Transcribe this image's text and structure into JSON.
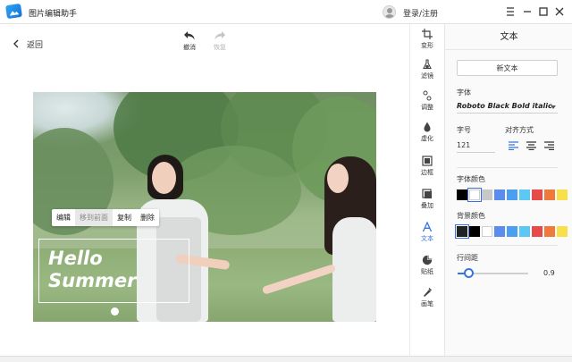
{
  "app": {
    "title": "图片编辑助手",
    "login": "登录/注册"
  },
  "toolbar": {
    "back": "返回",
    "undo": "撤消",
    "redo": "恢复"
  },
  "context_menu": {
    "items": [
      "编辑",
      "移到前面",
      "复制",
      "删除"
    ],
    "active_index": 1
  },
  "canvas": {
    "text_line1": "Hello",
    "text_line2": "Summer"
  },
  "sidebar": {
    "items": [
      {
        "label": "变形",
        "icon": "crop-icon"
      },
      {
        "label": "滤镜",
        "icon": "flask-icon"
      },
      {
        "label": "调整",
        "icon": "adjust-icon"
      },
      {
        "label": "虚化",
        "icon": "drop-icon"
      },
      {
        "label": "边框",
        "icon": "frame-icon"
      },
      {
        "label": "叠加",
        "icon": "overlay-icon"
      },
      {
        "label": "文本",
        "icon": "text-icon"
      },
      {
        "label": "贴纸",
        "icon": "sticker-icon"
      },
      {
        "label": "画笔",
        "icon": "brush-icon"
      }
    ],
    "active": "文本"
  },
  "panel": {
    "title": "文本",
    "new_text": "新文本",
    "font_label": "字体",
    "font_value": "Roboto Black Bold italic",
    "size_label": "字号",
    "size_value": "121",
    "align_label": "对齐方式",
    "align_options": [
      "align-left-icon",
      "align-center-icon",
      "align-right-icon"
    ],
    "font_color_label": "字体颜色",
    "font_colors": [
      "#000000",
      "#ffffff",
      "#c8c8c8",
      "#5b8def",
      "#4a9ff0",
      "#5bc8f5",
      "#e84a4a",
      "#f07a3c",
      "#f8e04a"
    ],
    "font_color_selected": 1,
    "bg_color_label": "背景颜色",
    "bg_colors": [
      "#222222",
      "#000000",
      "#ffffff",
      "#5b8def",
      "#4a9ff0",
      "#5bc8f5",
      "#e84a4a",
      "#f07a3c",
      "#f8e04a"
    ],
    "bg_color_selected": 0,
    "line_spacing_label": "行间距",
    "line_spacing_value": "0.9",
    "line_spacing_fraction": 0.15,
    "accent": "#3a73e0"
  }
}
